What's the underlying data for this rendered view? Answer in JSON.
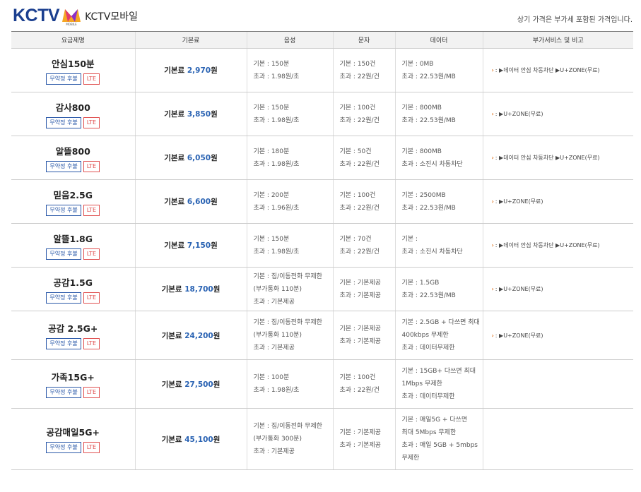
{
  "brand": {
    "logo_text": "KCTV",
    "logo_sub": "MOBILE",
    "name": "KCTV모바일"
  },
  "notice": "상기 가격은 부가세 포함된 가격입니다.",
  "colors": {
    "brand_blue": "#1b3f8f",
    "fee_blue": "#2a63b3",
    "tag_blue": "#2a58a8",
    "tag_red": "#e05050",
    "arrow_orange": "#e07a2a"
  },
  "table": {
    "headers": [
      "요금제명",
      "기본료",
      "음성",
      "문자",
      "데이터",
      "부가서비스 및 비고"
    ],
    "fee_prefix": "기본료 ",
    "fee_suffix": "원",
    "tag_contract": "무약정 후불",
    "tag_lte": "LTE",
    "rows": [
      {
        "name": "안심150분",
        "fee": "2,970",
        "voice": [
          "기본 : 150분",
          "초과 : 1.98원/초"
        ],
        "sms": [
          "기본 : 150건",
          "초과 : 22원/건"
        ],
        "data": [
          "기본 : 0MB",
          "초과 : 22.53원/MB"
        ],
        "extra": ": ▶데이터 안심 차동차단 ▶U+ZONE(무료)"
      },
      {
        "name": "감사800",
        "fee": "3,850",
        "voice": [
          "기본 : 150분",
          "초과 : 1.98원/초"
        ],
        "sms": [
          "기본 : 100건",
          "초과 : 22원/건"
        ],
        "data": [
          "기본 : 800MB",
          "초과 : 22.53원/MB"
        ],
        "extra": ": ▶U+ZONE(무료)"
      },
      {
        "name": "알뜰800",
        "fee": "6,050",
        "voice": [
          "기본 : 180분",
          "초과 : 1.98원/초"
        ],
        "sms": [
          "기본 : 50건",
          "초과 : 22원/건"
        ],
        "data": [
          "기본 : 800MB",
          "초과 : 소진시 차동차단"
        ],
        "extra": ": ▶데이터 안심 차동차단 ▶U+ZONE(무료)"
      },
      {
        "name": "믿음2.5G",
        "fee": "6,600",
        "voice": [
          "기본 : 200분",
          "초과 : 1.96원/초"
        ],
        "sms": [
          "기본 : 100건",
          "초과 : 22원/건"
        ],
        "data": [
          "기본 : 2500MB",
          "초과 : 22.53원/MB"
        ],
        "extra": ": ▶U+ZONE(무료)"
      },
      {
        "name": "알뜰1.8G",
        "fee": "7,150",
        "voice": [
          "기본 : 150분",
          "초과 : 1.98원/초"
        ],
        "sms": [
          "기본 : 70건",
          "초과 : 22원/건"
        ],
        "data": [
          "기본 :",
          "초과 : 소진시 차동차단"
        ],
        "extra": ": ▶데이터 안심 차동차단 ▶U+ZONE(무료)"
      },
      {
        "name": "공감1.5G",
        "fee": "18,700",
        "voice": [
          "기본 : 집/이동전화 무제한",
          "(부가통화 110분)",
          "초과 : 기본제공"
        ],
        "sms": [
          "기본 : 기본제공",
          "초과 : 기본제공"
        ],
        "data": [
          "기본 : 1.5GB",
          "초과 : 22.53원/MB"
        ],
        "extra": ": ▶U+ZONE(무료)"
      },
      {
        "name": "공감 2.5G+",
        "fee": "24,200",
        "voice": [
          "기본 : 집/이동전화 무제한",
          "(부가통화 110분)",
          "초과 : 기본제공"
        ],
        "sms": [
          "기본 : 기본제공",
          "초과 : 기본제공"
        ],
        "data": [
          "기본 : 2.5GB + 다쓰면 최대",
          "400kbps 무제한",
          "초과 : 데이터무제한"
        ],
        "extra": ": ▶U+ZONE(무료)"
      },
      {
        "name": "가족15G+",
        "fee": "27,500",
        "voice": [
          "기본 : 100분",
          "초과 : 1.98원/초"
        ],
        "sms": [
          "기본 : 100건",
          "초과 : 22원/건"
        ],
        "data": [
          "기본 : 15GB+ 다쓰면 최대",
          "1Mbps 무제한",
          "초과 : 데이터무제한"
        ],
        "extra": ""
      },
      {
        "name": "공감매일5G+",
        "fee": "45,100",
        "voice": [
          "기본 : 집/이동전화 무제한",
          "(부가통화 300분)",
          "초과 : 기본제공"
        ],
        "sms": [
          "기본 : 기본제공",
          "초과 : 기본제공"
        ],
        "data": [
          "기본 : 매일5G + 다쓰면",
          "최대 5Mbps 무제한",
          "초과 : 매일 5GB + 5mbps",
          "무제한"
        ],
        "extra": ""
      }
    ]
  }
}
